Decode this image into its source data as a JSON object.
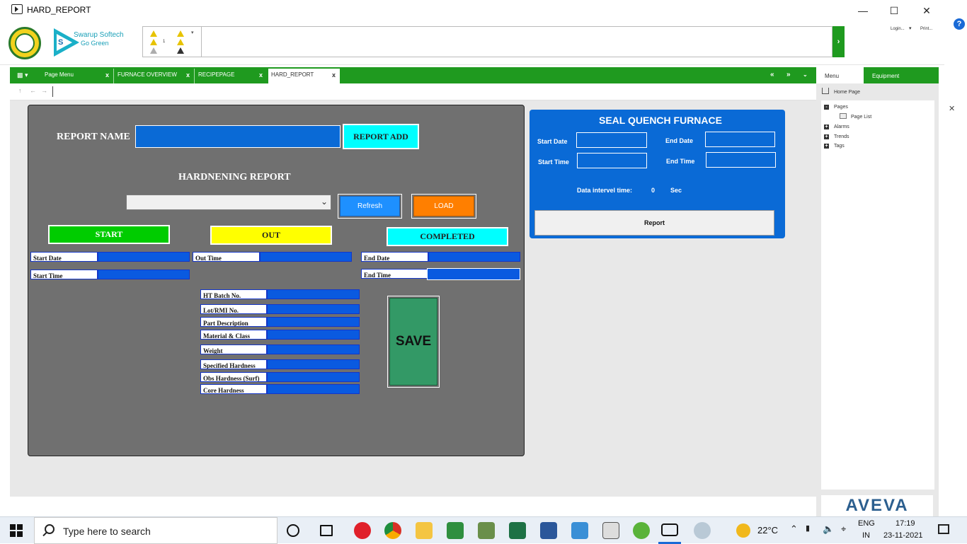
{
  "window": {
    "title": "HARD_REPORT"
  },
  "header": {
    "logo_tagline_1": "Swarup Softech",
    "logo_tagline_2": "Go Green",
    "logo_letter": "S",
    "alarm_count": "1",
    "login_label": "Login...",
    "print_label": "Print..."
  },
  "tabs": [
    {
      "label": "Page Menu"
    },
    {
      "label": "FURNACE OVERVIEW"
    },
    {
      "label": "RECIPEPAGE"
    },
    {
      "label": "HARD_REPORT"
    }
  ],
  "sidebar": {
    "tab_menu": "Menu",
    "tab_equipment": "Equipment",
    "home": "Home Page",
    "tree": {
      "pages": "Pages",
      "page_list": "Page List",
      "alarms": "Alarms",
      "trends": "Trends",
      "tags": "Tags"
    },
    "brand": "AVEVA"
  },
  "report": {
    "report_name_label": "REPORT NAME",
    "report_name_value": "",
    "report_add": "REPORT ADD",
    "heading": "HARDNENING REPORT",
    "dropdown_value": "",
    "refresh": "Refresh",
    "load": "LOAD",
    "start": "START",
    "out": "OUT",
    "completed": "COMPLETED",
    "start_date": "Start Date",
    "start_time": "Start Time",
    "out_time": "Out Time",
    "end_date": "End Date",
    "end_time": "End Time",
    "fields": [
      "HT Batch No.",
      "Lot/RMI No.",
      "Part Description",
      "Material & Class",
      "Weight",
      "Specified Hardness",
      "Obs Hardness (Surf)",
      "Core Hardness"
    ],
    "save": "SAVE"
  },
  "seal": {
    "title": "SEAL QUENCH FURNACE",
    "start_date": "Start Date",
    "end_date": "End Date",
    "start_time": "Start Time",
    "end_time": "End Time",
    "interval_label": "Data intervel time:",
    "interval_value": "0",
    "interval_unit": "Sec",
    "report_button": "Report"
  },
  "taskbar": {
    "search_placeholder": "Type here to search",
    "temperature": "22°C",
    "lang_1": "ENG",
    "lang_2": "IN",
    "time": "17:19",
    "date": "23-11-2021"
  },
  "colors": {
    "green_bar": "#1f9a1f",
    "panel_gray": "#707070",
    "panel_blue": "#0a6ad6",
    "start_green": "#00cc00",
    "out_yellow": "#ffff00",
    "completed_cyan": "#00ffff",
    "load_orange": "#ff7f00",
    "refresh_blue": "#1e90ff",
    "save_green": "#339966"
  }
}
